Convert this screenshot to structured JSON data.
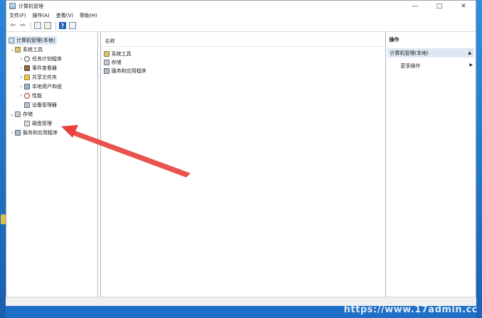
{
  "window": {
    "title": "计算机管理",
    "controls": {
      "minimize": "—",
      "maximize": "□",
      "close": "✕"
    }
  },
  "menu": [
    "文件(F)",
    "操作(A)",
    "查看(V)",
    "帮助(H)"
  ],
  "toolbar": {
    "back": "⇦",
    "forward": "⇨",
    "help": "?"
  },
  "tree": {
    "root": "计算机管理(本地)",
    "system_tools": "系统工具",
    "task_scheduler": "任务计划程序",
    "event_viewer": "事件查看器",
    "shared_folders": "共享文件夹",
    "local_users": "本地用户和组",
    "performance": "性能",
    "device_manager": "设备管理器",
    "storage": "存储",
    "disk_management": "磁盘管理",
    "services_apps": "服务和应用程序",
    "toggle_expanded": "⌄",
    "toggle_collapsed": "›"
  },
  "list": {
    "header": "名称",
    "items": [
      "系统工具",
      "存储",
      "服务和应用程序"
    ]
  },
  "actions": {
    "title": "操作",
    "section": "计算机管理(本地)",
    "section_arrow": "▲",
    "more": "更多操作",
    "more_arrow": "▶"
  },
  "watermark": "https://www.17admin.cc",
  "colors": {
    "desktop": "#1e6fc7",
    "arrow": "#e8403a",
    "selection": "#dbe8f5"
  }
}
